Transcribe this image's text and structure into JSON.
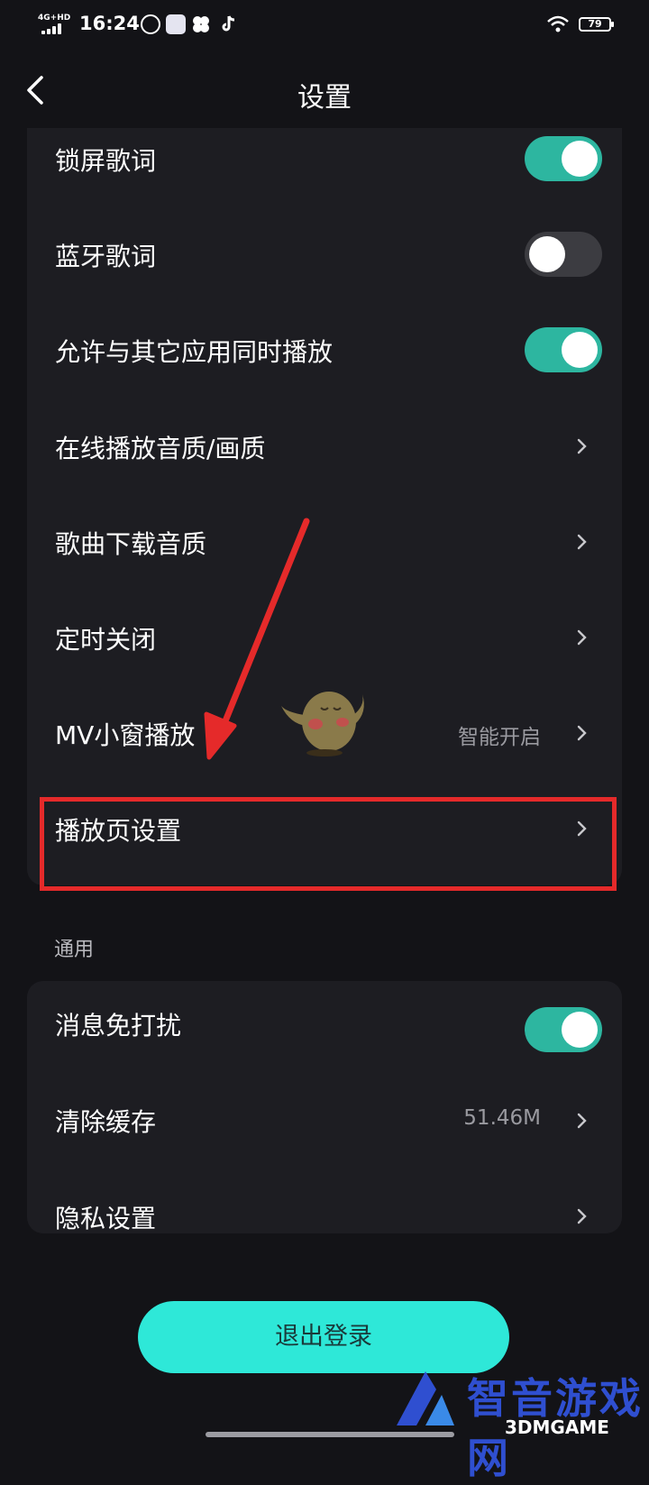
{
  "status_bar": {
    "network": "4G+HD",
    "time": "16:24",
    "battery": "79"
  },
  "header": {
    "title": "设置"
  },
  "playback_settings": [
    {
      "label": "锁屏歌词",
      "control": "toggle",
      "on": true
    },
    {
      "label": "蓝牙歌词",
      "control": "toggle",
      "on": false
    },
    {
      "label": "允许与其它应用同时播放",
      "control": "toggle",
      "on": true
    },
    {
      "label": "在线播放音质/画质",
      "control": "chevron"
    },
    {
      "label": "歌曲下载音质",
      "control": "chevron"
    },
    {
      "label": "定时关闭",
      "control": "chevron"
    },
    {
      "label": "MV小窗播放",
      "value": "智能开启",
      "control": "chevron"
    },
    {
      "label": "播放页设置",
      "control": "chevron",
      "highlighted": true
    }
  ],
  "general_section": {
    "title": "通用",
    "items": [
      {
        "label": "消息免打扰",
        "control": "toggle",
        "on": true
      },
      {
        "label": "清除缓存",
        "value": "51.46M",
        "control": "chevron"
      },
      {
        "label": "隐私设置",
        "control": "chevron"
      }
    ]
  },
  "logout_button": {
    "label": "退出登录"
  },
  "watermark": {
    "brand": "智音游戏网",
    "sub": "3DMGAME"
  },
  "colors": {
    "background": "#131317",
    "card": "#1d1d22",
    "toggle_on": "#2db6a0",
    "toggle_off": "#3c3c41",
    "logout_button": "#2ee8d8",
    "annotation_red": "#e52a2a"
  }
}
